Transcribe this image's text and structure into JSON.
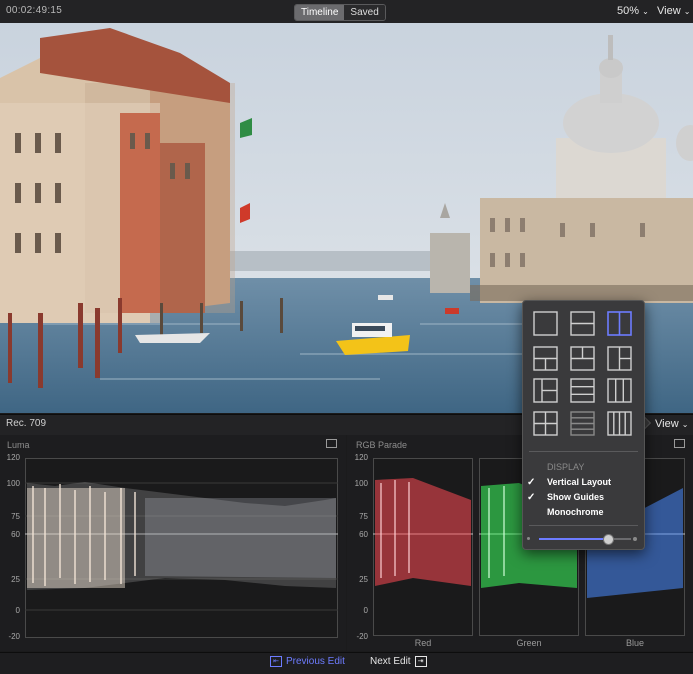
{
  "topbar": {
    "timecode": "00:02:49:15",
    "segments": [
      {
        "label": "Timeline",
        "selected": true
      },
      {
        "label": "Saved",
        "selected": false
      }
    ],
    "zoom": "50%",
    "view_label": "View"
  },
  "scopes_header": {
    "color_space": "Rec. 709",
    "view_label": "View"
  },
  "luma": {
    "title": "Luma",
    "ticks": [
      "120",
      "100",
      "75",
      "60",
      "25",
      "0",
      "-20"
    ]
  },
  "rgb": {
    "title": "RGB Parade",
    "ticks": [
      "120",
      "100",
      "75",
      "60",
      "25",
      "0",
      "-20"
    ],
    "channels": [
      {
        "name": "Red",
        "color": "#ff4a54"
      },
      {
        "name": "Green",
        "color": "#3cff5e"
      },
      {
        "name": "Blue",
        "color": "#4b8dff"
      }
    ]
  },
  "popover": {
    "layouts": [
      "single",
      "two-rows",
      "two-columns",
      "three-grid-top",
      "three-grid-left",
      "three-grid-right",
      "left-plus-rows",
      "three-rows",
      "three-columns",
      "four-grid",
      "four-rows",
      "four-columns"
    ],
    "selected_layout": 2,
    "section_title": "DISPLAY",
    "items": [
      {
        "label": "Vertical Layout",
        "checked": true
      },
      {
        "label": "Show Guides",
        "checked": true
      },
      {
        "label": "Monochrome",
        "checked": false
      }
    ],
    "brightness": 0.75
  },
  "bottombar": {
    "previous_label": "Previous Edit",
    "next_label": "Next Edit"
  },
  "colors": {
    "accent": "#6d7cff",
    "panel": "#1d1d1f"
  }
}
